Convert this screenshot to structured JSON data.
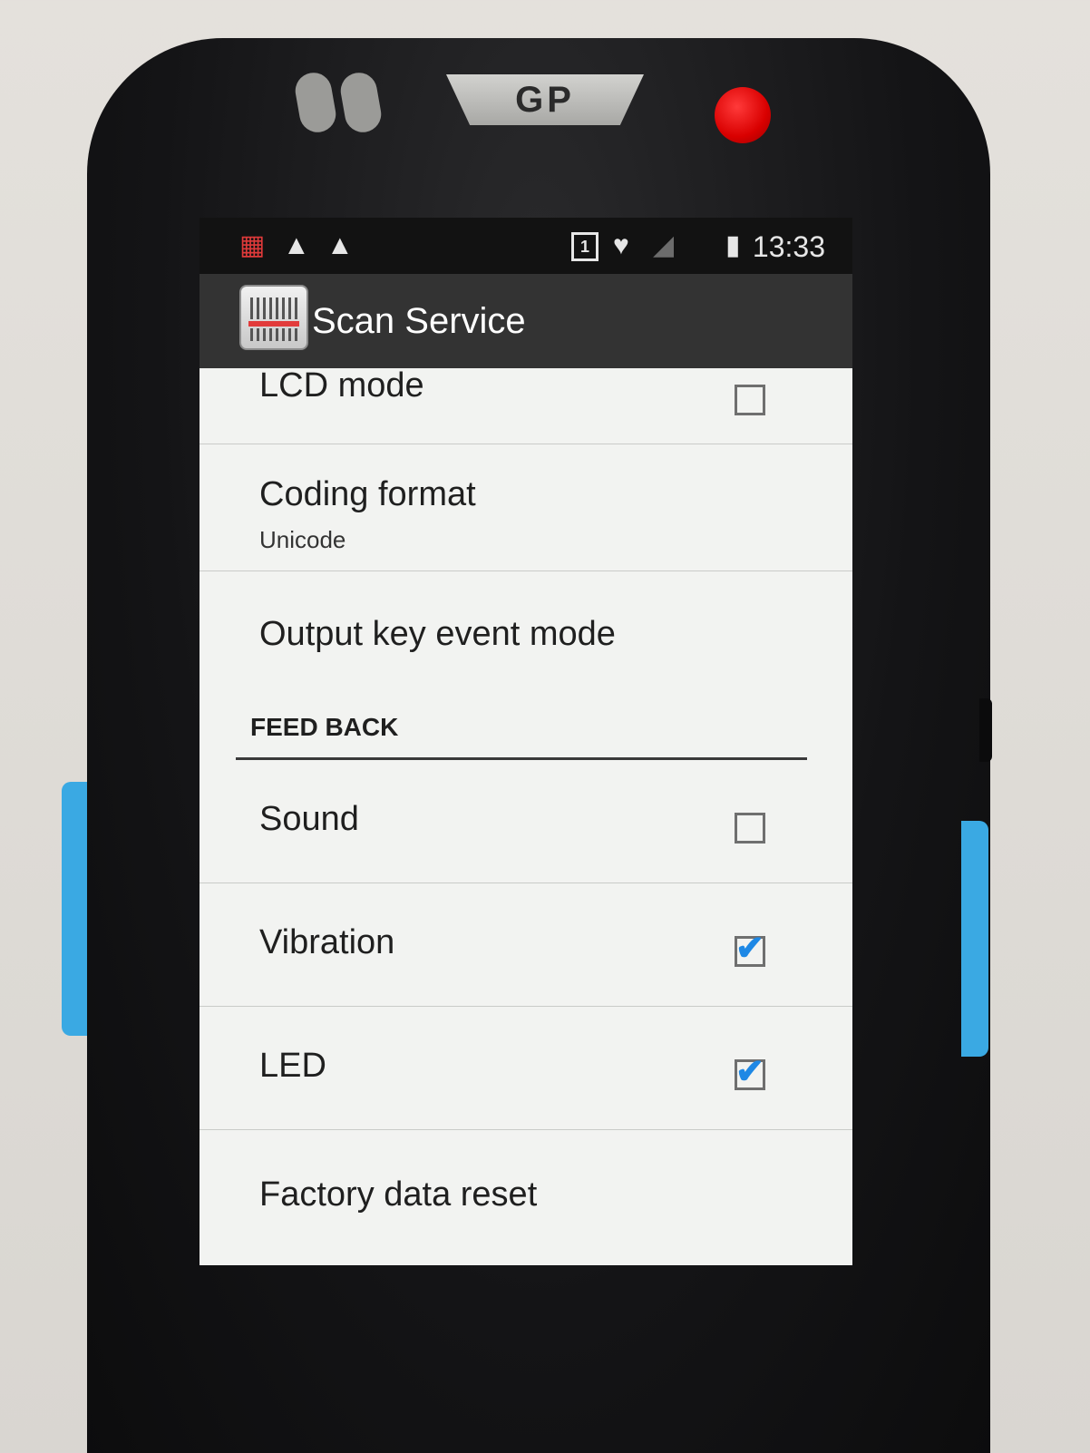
{
  "device": {
    "logo": "GP"
  },
  "status_bar": {
    "icons": [
      "scanner-notification-icon",
      "warning-icon",
      "warning-icon",
      "sim-card-icon",
      "heart-icon",
      "signal-icon",
      "battery-icon"
    ],
    "sim_label": "1",
    "time": "13:33"
  },
  "action_bar": {
    "app_icon": "scanner-app-icon",
    "title": "Scan Service"
  },
  "settings": {
    "lcd_mode": {
      "label": "LCD mode",
      "checked": false
    },
    "coding_format": {
      "label": "Coding format",
      "summary": "Unicode"
    },
    "output_key_event_mode": {
      "label": "Output key event mode"
    },
    "feedback_header": "FEED BACK",
    "sound": {
      "label": "Sound",
      "checked": false
    },
    "vibration": {
      "label": "Vibration",
      "checked": true
    },
    "led": {
      "label": "LED",
      "checked": true
    },
    "factory_reset": {
      "label": "Factory data reset"
    }
  },
  "colors": {
    "accent_check": "#1e88e5",
    "action_bar": "#333333",
    "status_bar": "#121212",
    "power_button": "#d90000",
    "side_keys": "#3aa9e3"
  }
}
